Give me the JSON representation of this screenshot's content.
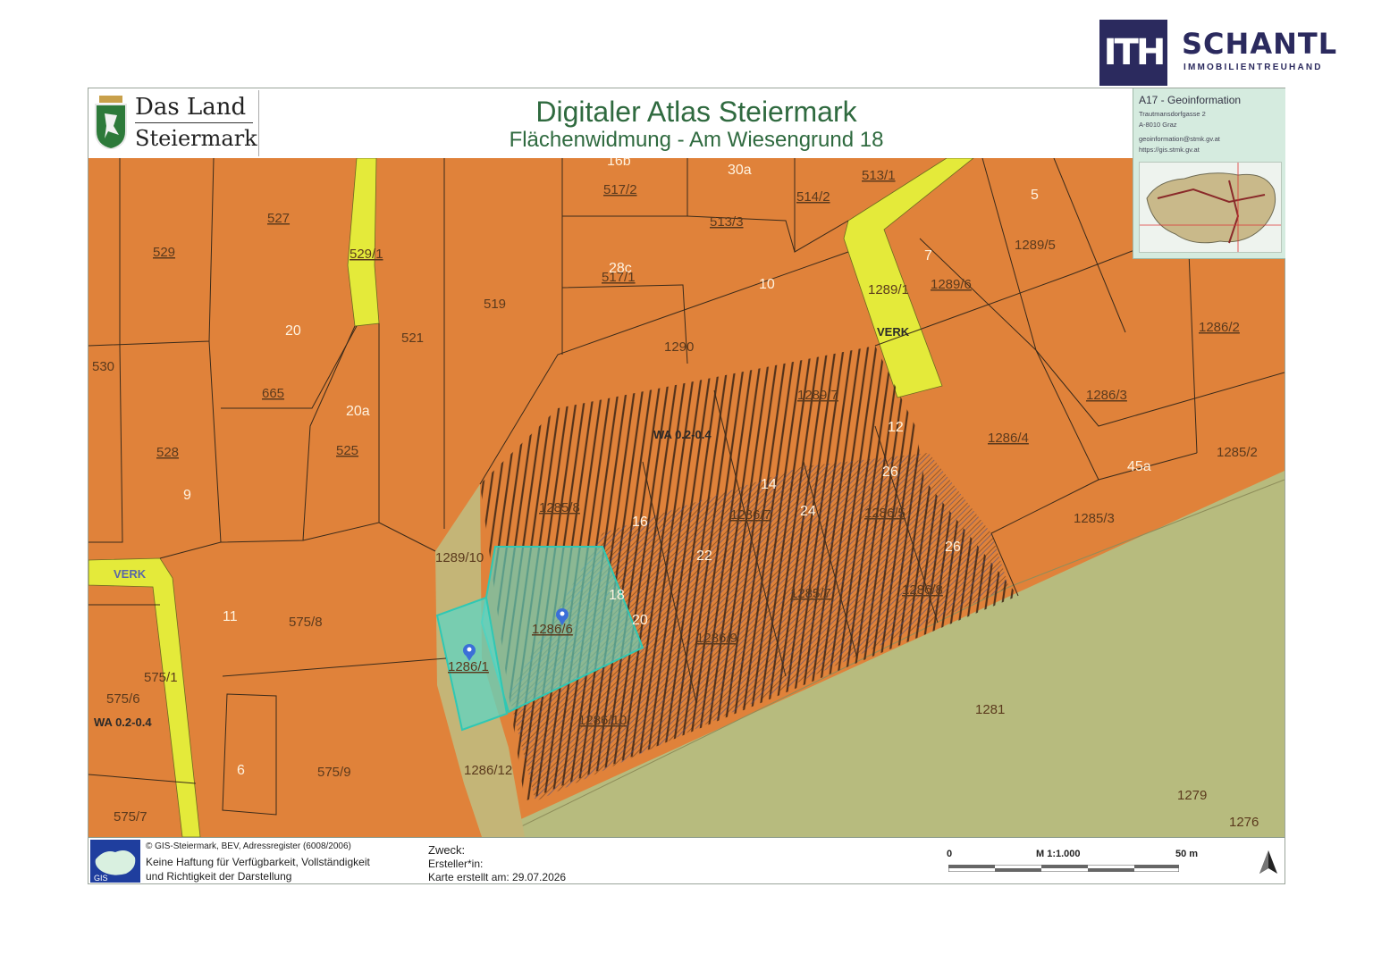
{
  "brand": {
    "mark": "ITH",
    "name": "SCHANTL",
    "subtitle": "IMMOBILIENTREUHAND",
    "color": "#2b2a5e"
  },
  "header": {
    "land_line1": "Das Land",
    "land_line2": "Steiermark",
    "title": "Digitaler Atlas Steiermark",
    "subtitle": "Flächenwidmung - Am Wiesengrund 18",
    "title_color": "#2f6a3f"
  },
  "info_box": {
    "title": "A17 - Geoinformation",
    "lines": [
      "Trautmansdorfgasse 2",
      "A-8010 Graz",
      "geoinformation@stmk.gv.at",
      "https://gis.stmk.gv.at"
    ]
  },
  "map": {
    "colors": {
      "building_land": "#e0823a",
      "traffic": "#e4ea3a",
      "green_land": "#b7bb7e",
      "highlight": "#5fd6c3",
      "hatch": "#3b2414",
      "hatch_blue": "#3b4a8a"
    },
    "labels": {
      "l529": "529",
      "l527": "527",
      "l529_1": "529/1",
      "l519": "519",
      "l517_2": "517/2",
      "l30a": "30a",
      "l16b": "16b",
      "l513_3": "513/3",
      "l514_2": "514/2",
      "l513_1": "513/1",
      "l5": "5",
      "l7": "7",
      "l1289_5": "1289/5",
      "l1289_1": "1289/1",
      "l1289_6": "1289/6",
      "l28c": "28c",
      "l517_1": "517/1",
      "l10": "10",
      "l20": "20",
      "l530": "530",
      "l521": "521",
      "l665": "665",
      "l20a": "20a",
      "l1290": "1290",
      "l1289_7": "1289/7",
      "l1286_2": "1286/2",
      "l1286_3": "1286/3",
      "l12": "12",
      "l528": "528",
      "l525": "525",
      "l9": "9",
      "l1286_4": "1286/4",
      "l45a": "45a",
      "l1285_2": "1285/2",
      "l26": "26",
      "l14": "14",
      "l1285_8": "1285/8",
      "l24": "24",
      "l1285_3": "1285/3",
      "l1289_10": "1289/10",
      "l16": "16",
      "l1286_7": "1286/7",
      "l1286_5": "1286/5",
      "l22": "22",
      "l26b": "26",
      "l575_8": "575/8",
      "l11": "11",
      "l18": "18",
      "l20b": "20",
      "l1286_1": "1286/1",
      "l1286_9": "1286/9",
      "l1286_8": "1286/8",
      "l575_1": "575/1",
      "l575_6": "575/6",
      "l1281": "1281",
      "l1286_10": "1286/10",
      "l6": "6",
      "l575_9": "575/9",
      "l1286_12": "1286/12",
      "l1279": "1279",
      "l575_7": "575/7",
      "l1276": "1276",
      "l1285_7": "1285/7",
      "l1286_6": "1286/6"
    },
    "zone_labels": {
      "verk1": "VERK",
      "verk2": "VERK",
      "wa1": "WA 0.2-0.4",
      "wa2": "WA 0.2-0.4"
    },
    "highlighted_parcels": [
      "1286/1",
      "1286/6"
    ]
  },
  "footer": {
    "copyright": "© GIS-Steiermark, BEV, Adressregister (6008/2006)",
    "disclaimer1": "Keine Haftung für Verfügbarkeit, Vollständigkeit",
    "disclaimer2": "und Richtigkeit der Darstellung",
    "zweck": "Zweck:",
    "ersteller": "Ersteller*in:",
    "karte": "Karte erstellt am: 29.07.2026",
    "scale_start": "0",
    "scale_label": "M 1:1.000",
    "scale_end": "50 m"
  }
}
